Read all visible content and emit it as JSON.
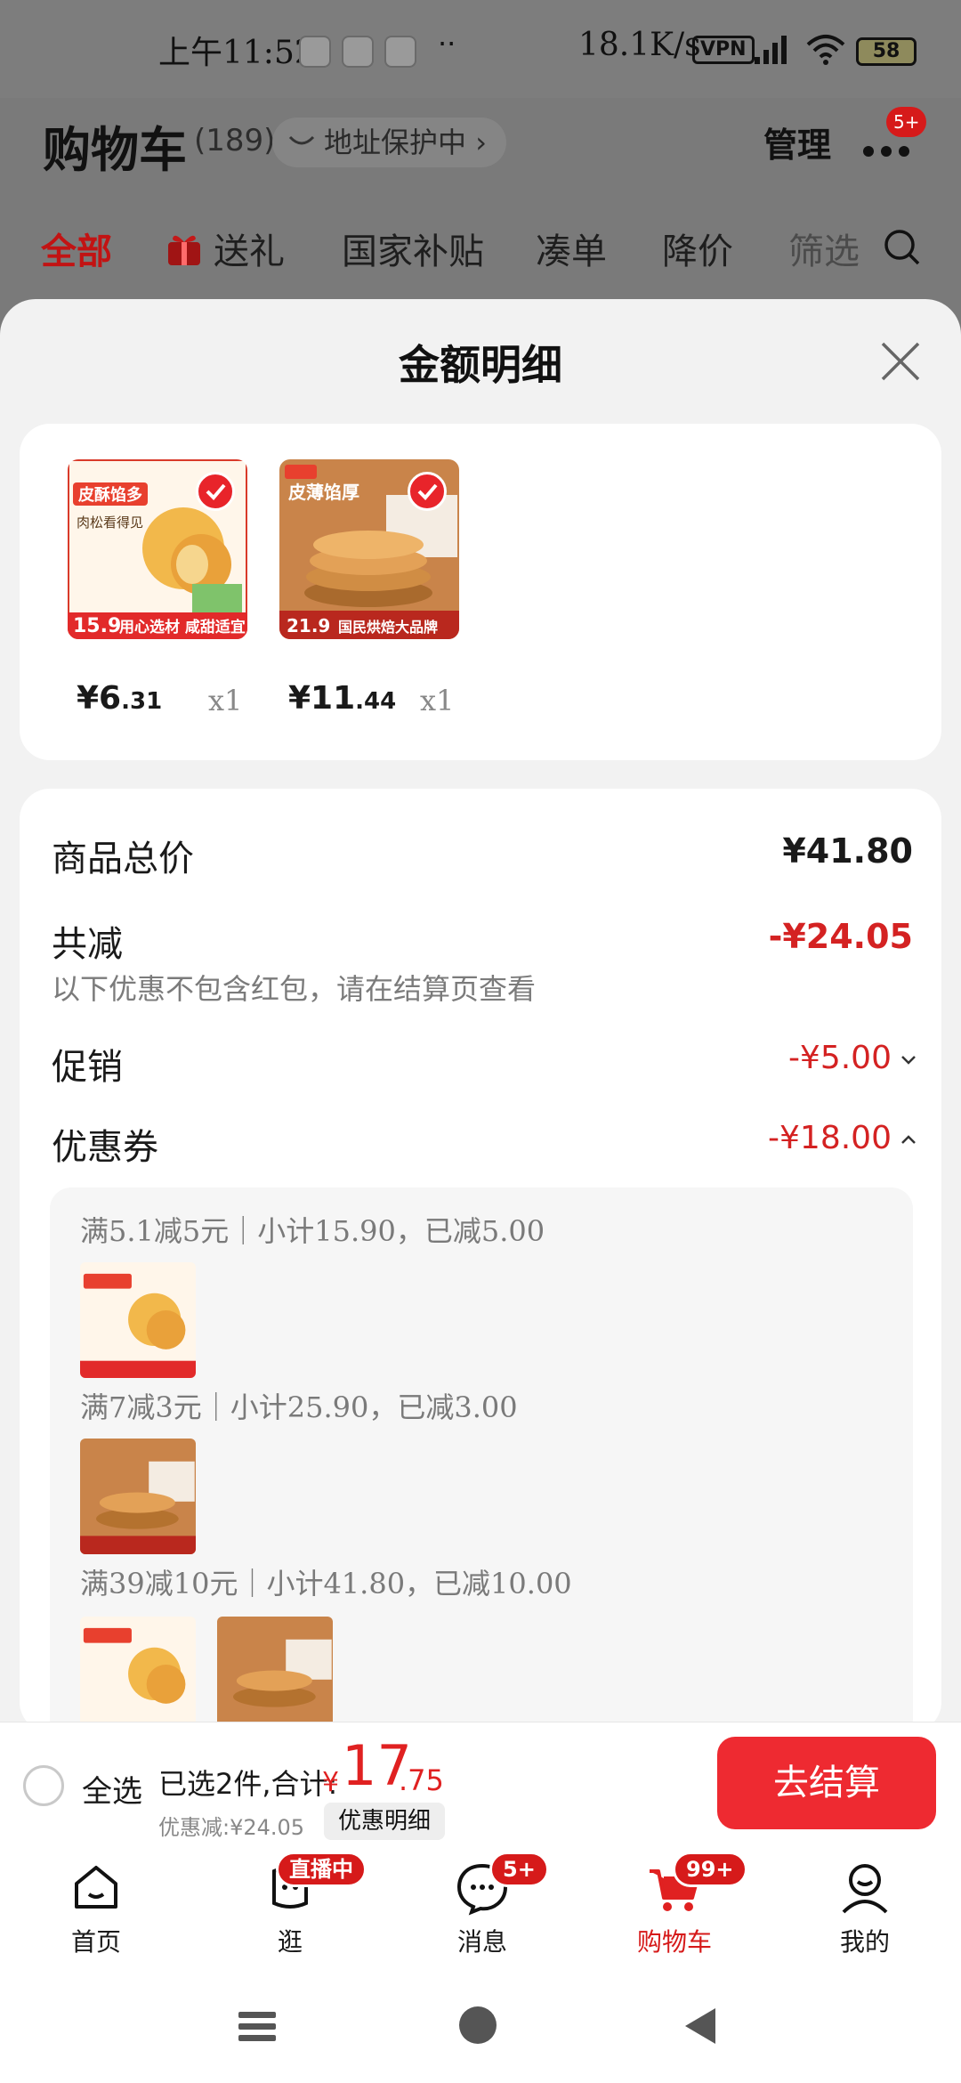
{
  "status_bar": {
    "time": "上午11:52",
    "dots": "··",
    "net_speed": "18.1K/s",
    "vpn": "VPN",
    "battery": "58"
  },
  "header": {
    "title": "购物车",
    "count": "(189)",
    "address_label": "地址保护中",
    "manage": "管理",
    "more_badge": "5+",
    "tabs": [
      "全部",
      "送礼",
      "国家补贴",
      "凑单",
      "降价",
      "筛选"
    ]
  },
  "sheet": {
    "title": "金额明细",
    "products": [
      {
        "price_int": "¥6",
        "price_dec": ".31",
        "qty": "x1",
        "badge_text": "皮酥馅多",
        "sub_text": "肉松看得见",
        "price_tag": "15.9",
        "footer_text": "用心选材 咸甜适宜"
      },
      {
        "price_int": "¥11",
        "price_dec": ".44",
        "qty": "x1",
        "badge_text": "皮薄馅厚",
        "sub_text": "",
        "price_tag": "21.9",
        "footer_text": "国民烘焙大品牌"
      }
    ],
    "summary": {
      "total_label": "商品总价",
      "total_value": "¥41.80",
      "reduce_label": "共减",
      "reduce_value": "-¥24.05",
      "reduce_note": "以下优惠不包含红包，请在结算页查看",
      "promo_label": "促销",
      "promo_value": "-¥5.00",
      "coupon_label": "优惠券",
      "coupon_value": "-¥18.00"
    },
    "coupons": [
      "满5.1减5元｜小计15.90，已减5.00",
      "满7减3元｜小计25.90，已减3.00",
      "满39减10元｜小计41.80，已减10.00"
    ]
  },
  "checkout": {
    "select_all": "全选",
    "selected_text": "已选2件,合计:",
    "yen": "¥",
    "total_int": "17",
    "total_dec": ".75",
    "saved_text": "优惠减:¥24.05",
    "detail_button": "优惠明细",
    "checkout_button": "去结算"
  },
  "tabbar": [
    {
      "label": "首页",
      "badge": ""
    },
    {
      "label": "逛",
      "badge": "直播中"
    },
    {
      "label": "消息",
      "badge": "5+"
    },
    {
      "label": "购物车",
      "badge": "99+"
    },
    {
      "label": "我的",
      "badge": ""
    }
  ],
  "colors": {
    "accent": "#e02121",
    "checkout_button": "#ee2a31",
    "page_bg": "#f2f2f2",
    "overlay": "#7a7a7a"
  }
}
